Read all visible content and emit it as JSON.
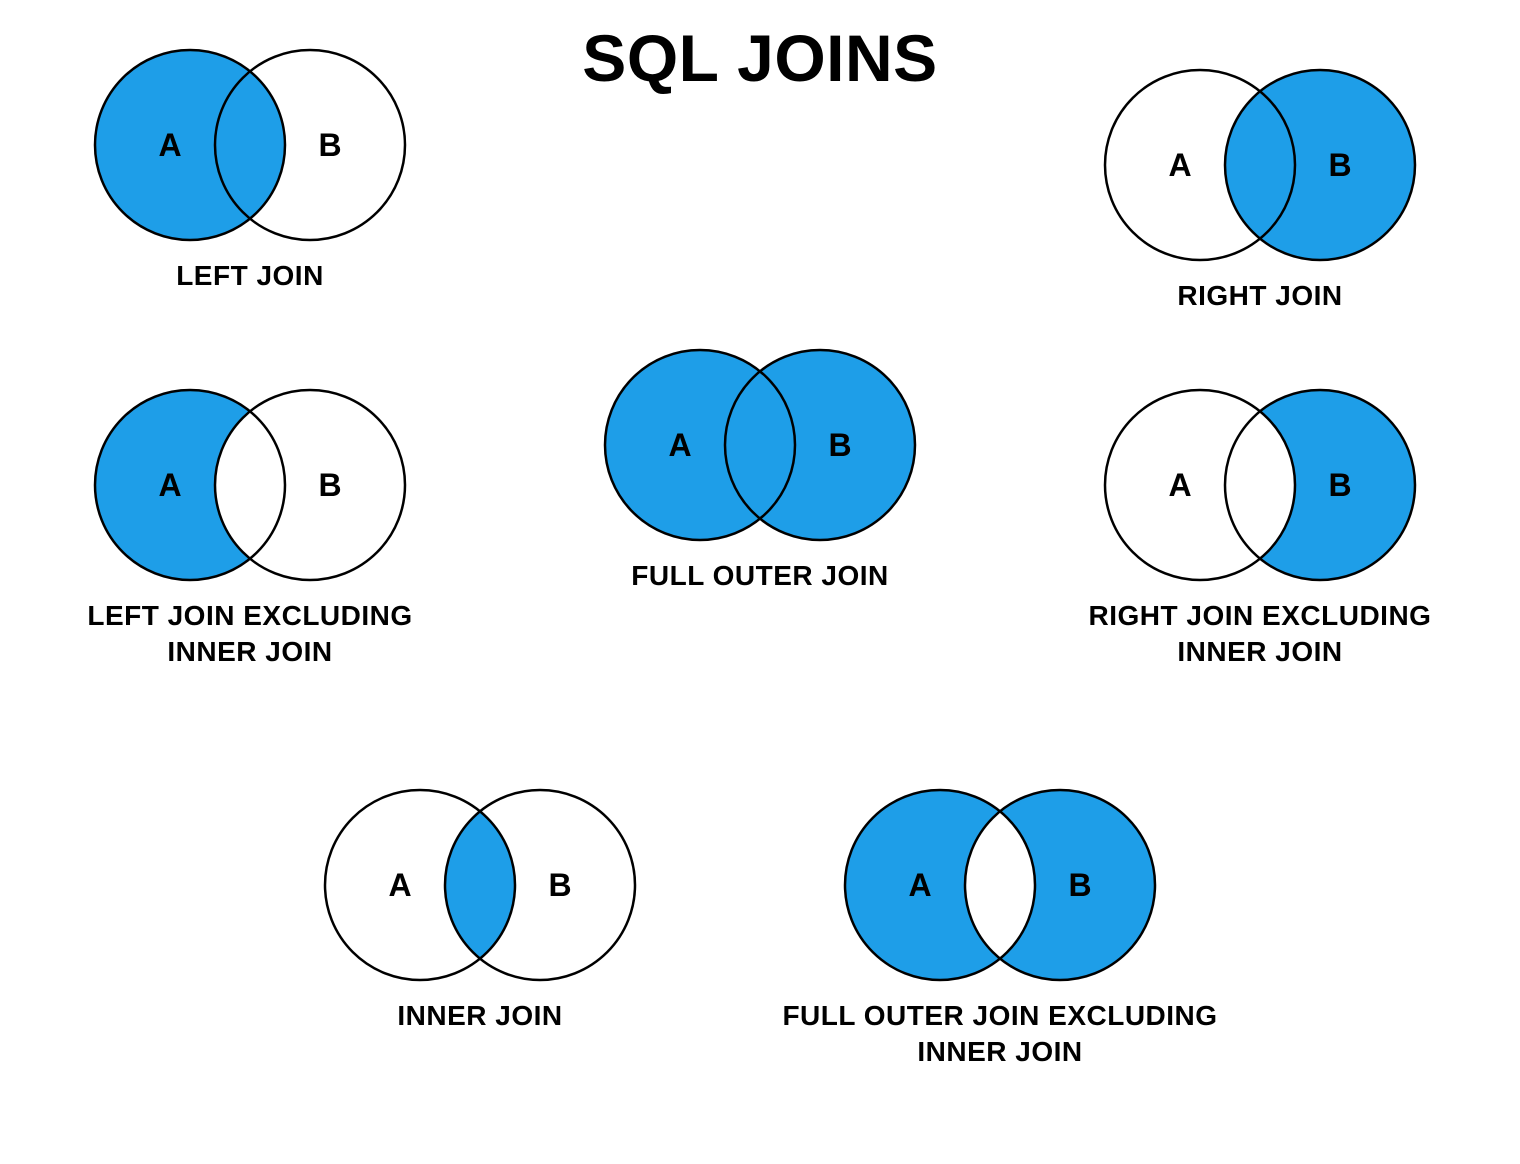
{
  "title": "SQL JOINS",
  "colors": {
    "highlight": "#1e9ee8",
    "background": "#ffffff",
    "outline": "#000000"
  },
  "sets": {
    "left": "A",
    "right": "B"
  },
  "joins": {
    "left_join": {
      "caption": "LEFT JOIN",
      "fill": {
        "left_only": true,
        "intersection": true,
        "right_only": false
      }
    },
    "right_join": {
      "caption": "RIGHT JOIN",
      "fill": {
        "left_only": false,
        "intersection": true,
        "right_only": true
      }
    },
    "left_join_excl": {
      "caption": "LEFT JOIN EXCLUDING INNER JOIN",
      "fill": {
        "left_only": true,
        "intersection": false,
        "right_only": false
      }
    },
    "full_outer_join": {
      "caption": "FULL OUTER JOIN",
      "fill": {
        "left_only": true,
        "intersection": true,
        "right_only": true
      }
    },
    "right_join_excl": {
      "caption": "RIGHT JOIN EXCLUDING INNER JOIN",
      "fill": {
        "left_only": false,
        "intersection": false,
        "right_only": true
      }
    },
    "inner_join": {
      "caption": "INNER JOIN",
      "fill": {
        "left_only": false,
        "intersection": true,
        "right_only": false
      }
    },
    "full_outer_join_excl": {
      "caption": "FULL OUTER JOIN EXCLUDING INNER JOIN",
      "fill": {
        "left_only": true,
        "intersection": false,
        "right_only": true
      }
    }
  }
}
